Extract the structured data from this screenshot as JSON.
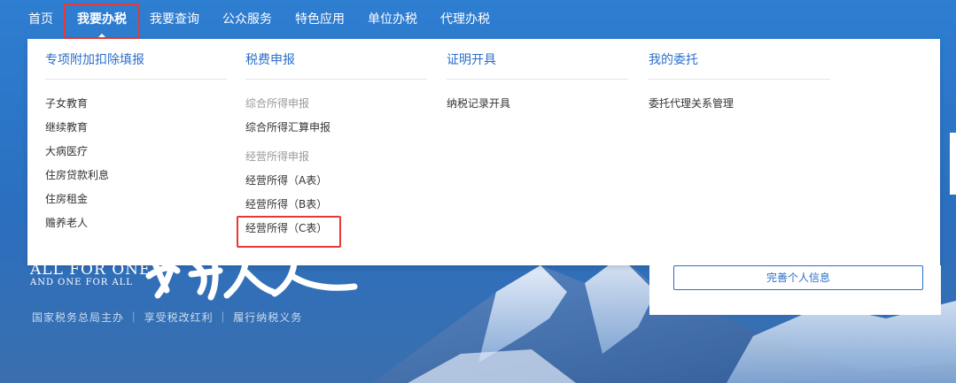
{
  "nav": {
    "items": [
      {
        "label": "首页"
      },
      {
        "label": "我要办税"
      },
      {
        "label": "我要查询"
      },
      {
        "label": "公众服务"
      },
      {
        "label": "特色应用"
      },
      {
        "label": "单位办税"
      },
      {
        "label": "代理办税"
      }
    ],
    "active_index": 1
  },
  "dropdown": {
    "columns": [
      {
        "title": "专项附加扣除填报",
        "items": [
          "子女教育",
          "继续教育",
          "大病医疗",
          "住房贷款利息",
          "住房租金",
          "赡养老人"
        ]
      },
      {
        "title": "税费申报",
        "groups": [
          {
            "heading": "综合所得申报",
            "items": [
              "综合所得汇算申报"
            ]
          },
          {
            "heading": "经营所得申报",
            "items": [
              "经营所得（A表）",
              "经营所得（B表）",
              "经营所得（C表）"
            ]
          }
        ]
      },
      {
        "title": "证明开具",
        "items": [
          "纳税记录开具"
        ]
      },
      {
        "title": "我的委托",
        "items": [
          "委托代理关系管理"
        ]
      }
    ]
  },
  "card": {
    "button_label": "完善个人信息"
  },
  "banner": {
    "slogan_en_line1": "ALL FOR ONE",
    "slogan_en_line2": "AND ONE FOR ALL",
    "calligraphy_text": "我为人人",
    "slogan_cn": "国家税务总局主办 ｜ 享受税改红利 ｜ 履行纳税义务"
  },
  "colors": {
    "nav_bg": "#2e7ed1",
    "accent": "#2b6fc9",
    "highlight": "#e53935"
  }
}
